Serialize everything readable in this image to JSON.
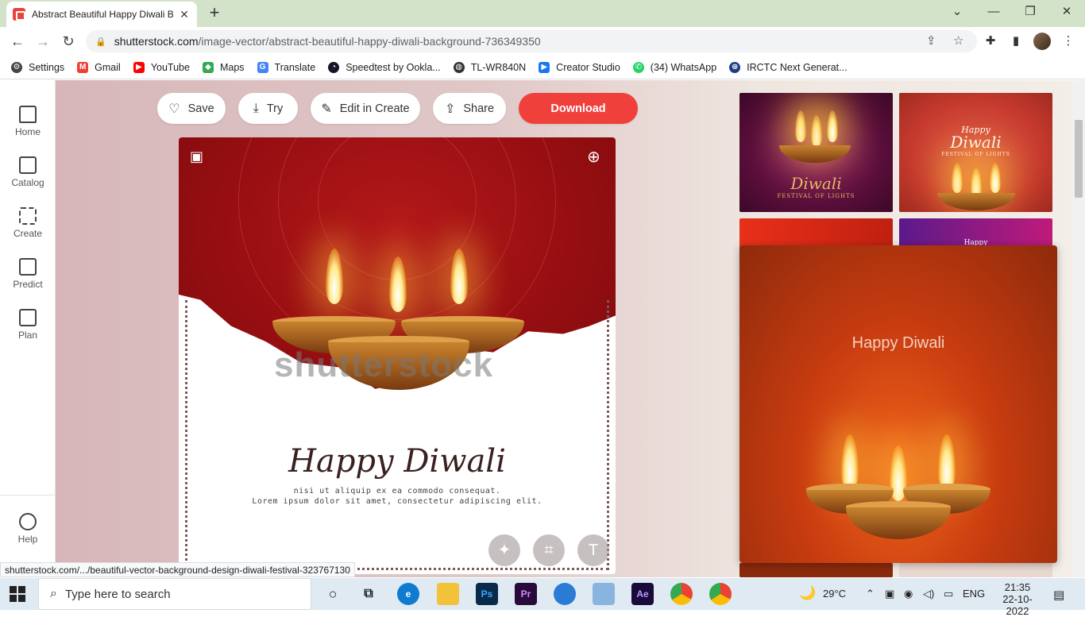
{
  "browser": {
    "tab_title": "Abstract Beautiful Happy Diwali B",
    "url_domain": "shutterstock.com",
    "url_path": "/image-vector/abstract-beautiful-happy-diwali-background-736349350"
  },
  "bookmarks": [
    {
      "label": "Settings",
      "icon": "gear-icon",
      "color": "#444444"
    },
    {
      "label": "Gmail",
      "icon": "gmail-icon",
      "color": "#ea4335"
    },
    {
      "label": "YouTube",
      "icon": "youtube-icon",
      "color": "#ff0000"
    },
    {
      "label": "Maps",
      "icon": "maps-icon",
      "color": "#34a853"
    },
    {
      "label": "Translate",
      "icon": "translate-icon",
      "color": "#4285f4"
    },
    {
      "label": "Speedtest by Ookla...",
      "icon": "speedtest-icon",
      "color": "#141526"
    },
    {
      "label": "TL-WR840N",
      "icon": "globe-icon",
      "color": "#333333"
    },
    {
      "label": "Creator Studio",
      "icon": "creator-studio-icon",
      "color": "#1877f2"
    },
    {
      "label": "(34) WhatsApp",
      "icon": "whatsapp-icon",
      "color": "#25d366"
    },
    {
      "label": "IRCTC Next Generat...",
      "icon": "irctc-icon",
      "color": "#1f3c88"
    }
  ],
  "leftnav": [
    {
      "label": "Home",
      "icon": "home-icon"
    },
    {
      "label": "Catalog",
      "icon": "catalog-icon"
    },
    {
      "label": "Create",
      "icon": "create-icon"
    },
    {
      "label": "Predict",
      "icon": "predict-icon"
    },
    {
      "label": "Plan",
      "icon": "plan-icon"
    },
    {
      "label": "Help",
      "icon": "help-icon"
    }
  ],
  "actions": {
    "save": "Save",
    "try": "Try",
    "edit": "Edit in Create",
    "share": "Share",
    "download": "Download",
    "download_color": "#f0403c"
  },
  "main_image": {
    "watermark": "shutterstock",
    "heading": "Happy Diwali",
    "line1": "nisi ut aliquip ex ea commodo consequat.",
    "line2": "Lorem ipsum dolor sit amet, consectetur adipiscing elit."
  },
  "thumbs": {
    "t1_title": "Diwali",
    "t1_sub": "FESTIVAL OF LIGHTS",
    "t2_title": "Diwali",
    "t2_happy": "Happy",
    "t2_sub": "FESTIVAL OF LIGHTS",
    "t4_label": "Happy"
  },
  "preview": {
    "heading": "Happy Diwali"
  },
  "status_url": "shutterstock.com/.../beautiful-vector-background-design-diwali-festival-323767130",
  "taskbar": {
    "search_placeholder": "Type here to search",
    "weather": "29°C",
    "lang": "ENG",
    "time": "21:35",
    "date": "22-10-2022"
  }
}
